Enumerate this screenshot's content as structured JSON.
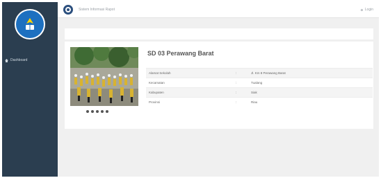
{
  "app": {
    "title": "Sistem Informasi Rapot"
  },
  "header": {
    "login_label": "Login"
  },
  "sidebar": {
    "items": [
      {
        "label": "Dashboard",
        "icon": "home-icon"
      }
    ]
  },
  "school": {
    "name": "SD 03 Perawang Barat",
    "fields": [
      {
        "label": "Alamat Sekolah",
        "sep": ":",
        "value": "Jl. Km 8 Perawang Barat"
      },
      {
        "label": "Kecamatan",
        "sep": ":",
        "value": "Tualang"
      },
      {
        "label": "Kabupaten",
        "sep": ":",
        "value": "Siak"
      },
      {
        "label": "Provinsi",
        "sep": ":",
        "value": "Riau"
      }
    ]
  },
  "carousel": {
    "slide_count": 5,
    "active_index": 0
  },
  "colors": {
    "sidebar": "#2b3e50",
    "background": "#f0f0f0",
    "card": "#ffffff",
    "accent": "#1d70c0"
  }
}
